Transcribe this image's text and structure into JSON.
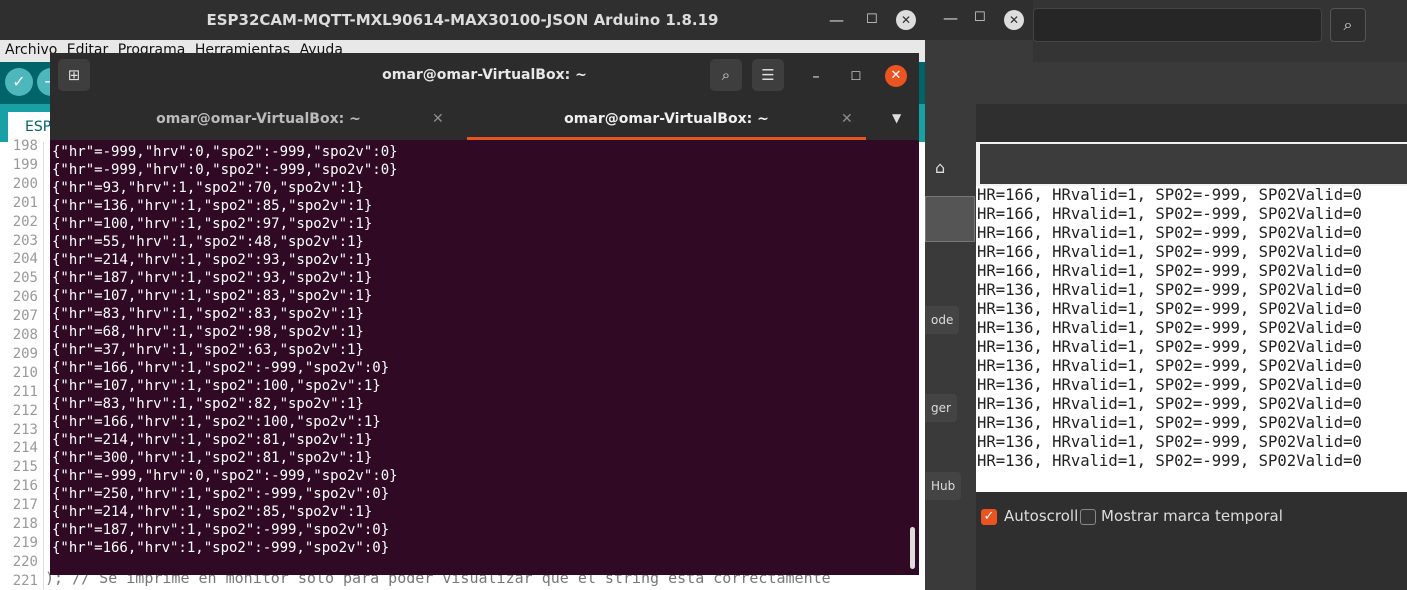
{
  "arduino": {
    "title": "ESP32CAM-MQTT-MXL90614-MAX30100-JSON Arduino 1.8.19",
    "menu": [
      "Archivo",
      "Editar",
      "Programa",
      "Herramientas",
      "Ayuda"
    ],
    "tab_label": "ESP",
    "line_numbers": [
      "198",
      "199",
      "200",
      "201",
      "202",
      "203",
      "204",
      "205",
      "206",
      "207",
      "208",
      "209",
      "210",
      "211",
      "212",
      "213",
      "214",
      "215",
      "216",
      "217",
      "218",
      "219",
      "220",
      "221"
    ],
    "code_tail": "); // Se imprime en monitor solo para poder visualizar que el string esta correctamente"
  },
  "terminal": {
    "title": "omar@omar-VirtualBox: ~",
    "tabs": [
      {
        "label": "omar@omar-VirtualBox: ~",
        "active": false
      },
      {
        "label": "omar@omar-VirtualBox: ~",
        "active": true
      }
    ],
    "lines": [
      "{\"hr\"=-999,\"hrv\":0,\"spo2\":-999,\"spo2v\":0}",
      "{\"hr\"=-999,\"hrv\":0,\"spo2\":-999,\"spo2v\":0}",
      "{\"hr\"=93,\"hrv\":1,\"spo2\":70,\"spo2v\":1}",
      "{\"hr\"=136,\"hrv\":1,\"spo2\":85,\"spo2v\":1}",
      "{\"hr\"=100,\"hrv\":1,\"spo2\":97,\"spo2v\":1}",
      "{\"hr\"=55,\"hrv\":1,\"spo2\":48,\"spo2v\":1}",
      "{\"hr\"=214,\"hrv\":1,\"spo2\":93,\"spo2v\":1}",
      "{\"hr\"=187,\"hrv\":1,\"spo2\":93,\"spo2v\":1}",
      "{\"hr\"=107,\"hrv\":1,\"spo2\":83,\"spo2v\":1}",
      "{\"hr\"=83,\"hrv\":1,\"spo2\":83,\"spo2v\":1}",
      "{\"hr\"=68,\"hrv\":1,\"spo2\":98,\"spo2v\":1}",
      "{\"hr\"=37,\"hrv\":1,\"spo2\":63,\"spo2v\":1}",
      "{\"hr\"=166,\"hrv\":1,\"spo2\":-999,\"spo2v\":0}",
      "{\"hr\"=107,\"hrv\":1,\"spo2\":100,\"spo2v\":1}",
      "{\"hr\"=83,\"hrv\":1,\"spo2\":82,\"spo2v\":1}",
      "{\"hr\"=166,\"hrv\":1,\"spo2\":100,\"spo2v\":1}",
      "{\"hr\"=214,\"hrv\":1,\"spo2\":81,\"spo2v\":1}",
      "{\"hr\"=300,\"hrv\":1,\"spo2\":81,\"spo2v\":1}",
      "{\"hr\"=-999,\"hrv\":0,\"spo2\":-999,\"spo2v\":0}",
      "{\"hr\"=250,\"hrv\":1,\"spo2\":-999,\"spo2v\":0}",
      "{\"hr\"=214,\"hrv\":1,\"spo2\":85,\"spo2v\":1}",
      "{\"hr\"=187,\"hrv\":1,\"spo2\":-999,\"spo2v\":0}",
      "{\"hr\"=166,\"hrv\":1,\"spo2\":-999,\"spo2v\":0}"
    ]
  },
  "serial_monitor": {
    "lines": [
      "HR=166, HRvalid=1, SP02=-999, SP02Valid=0",
      "HR=166, HRvalid=1, SP02=-999, SP02Valid=0",
      "HR=166, HRvalid=1, SP02=-999, SP02Valid=0",
      "HR=166, HRvalid=1, SP02=-999, SP02Valid=0",
      "HR=166, HRvalid=1, SP02=-999, SP02Valid=0",
      "HR=136, HRvalid=1, SP02=-999, SP02Valid=0",
      "HR=136, HRvalid=1, SP02=-999, SP02Valid=0",
      "HR=136, HRvalid=1, SP02=-999, SP02Valid=0",
      "HR=136, HRvalid=1, SP02=-999, SP02Valid=0",
      "HR=136, HRvalid=1, SP02=-999, SP02Valid=0",
      "HR=136, HRvalid=1, SP02=-999, SP02Valid=0",
      "HR=136, HRvalid=1, SP02=-999, SP02Valid=0",
      "HR=136, HRvalid=1, SP02=-999, SP02Valid=0",
      "HR=136, HRvalid=1, SP02=-999, SP02Valid=0",
      "HR=136, HRvalid=1, SP02=-999, SP02Valid=0"
    ],
    "autoscroll_label": "Autoscroll",
    "autoscroll_checked": true,
    "timestamp_label": "Mostrar marca temporal",
    "timestamp_checked": false,
    "side_buttons": [
      "ode",
      "ger",
      "Hub"
    ]
  },
  "colors": {
    "terminal_bg": "#300a24",
    "accent": "#e95420",
    "arduino_teal": "#006468"
  }
}
